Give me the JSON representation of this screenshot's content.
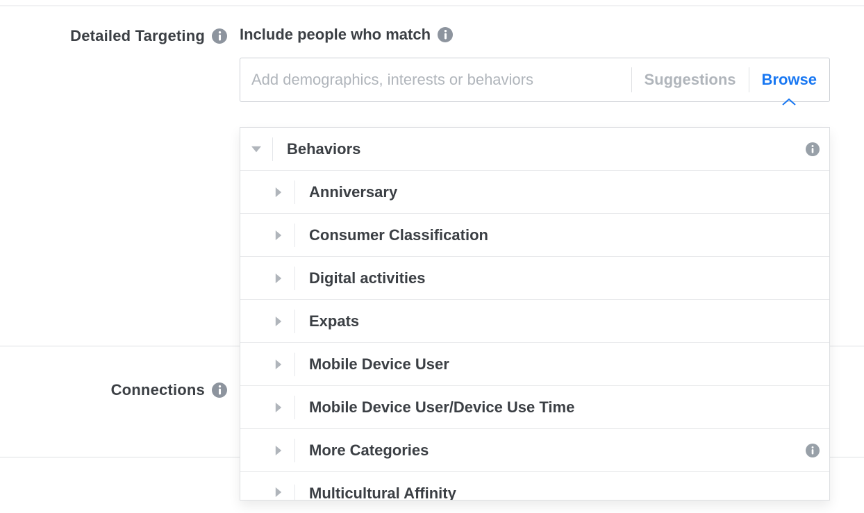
{
  "sections": {
    "detailed_targeting": {
      "label": "Detailed Targeting"
    },
    "connections": {
      "label": "Connections"
    }
  },
  "include": {
    "label": "Include people who match",
    "placeholder": "Add demographics, interests or behaviors",
    "suggestions_label": "Suggestions",
    "browse_label": "Browse"
  },
  "dropdown": {
    "root": {
      "label": "Behaviors",
      "expanded": true,
      "has_info": true
    },
    "children": [
      {
        "label": "Anniversary",
        "has_info": false
      },
      {
        "label": "Consumer Classification",
        "has_info": false
      },
      {
        "label": "Digital activities",
        "has_info": false
      },
      {
        "label": "Expats",
        "has_info": false
      },
      {
        "label": "Mobile Device User",
        "has_info": false
      },
      {
        "label": "Mobile Device User/Device Use Time",
        "has_info": false
      },
      {
        "label": "More Categories",
        "has_info": true
      },
      {
        "label": "Multicultural Affinity",
        "has_info": false
      }
    ]
  }
}
